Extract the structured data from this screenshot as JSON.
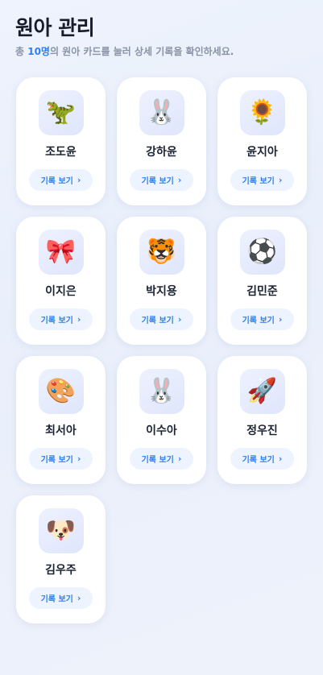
{
  "header": {
    "title": "원아 관리",
    "subtitle_prefix": "총 ",
    "subtitle_count": "10명",
    "subtitle_suffix": "의 원아 카드를 눌러 상세 기록을 확인하세요."
  },
  "record_button_label": "기록 보기",
  "chevron": "›",
  "children": [
    {
      "name": "조도윤",
      "icon": "dinosaur-icon",
      "emoji": "🦖"
    },
    {
      "name": "강하윤",
      "icon": "rabbit-icon",
      "emoji": "🐰"
    },
    {
      "name": "윤지아",
      "icon": "sunflower-icon",
      "emoji": "🌻"
    },
    {
      "name": "이지은",
      "icon": "ribbon-icon",
      "emoji": "🎀"
    },
    {
      "name": "박지용",
      "icon": "tiger-icon",
      "emoji": "🐯"
    },
    {
      "name": "김민준",
      "icon": "soccer-ball-icon",
      "emoji": "⚽"
    },
    {
      "name": "최서아",
      "icon": "palette-icon",
      "emoji": "🎨"
    },
    {
      "name": "이수아",
      "icon": "rabbit-icon",
      "emoji": "🐰"
    },
    {
      "name": "정우진",
      "icon": "rocket-icon",
      "emoji": "🚀"
    },
    {
      "name": "김우주",
      "icon": "dog-icon",
      "emoji": "🐶"
    }
  ],
  "colors": {
    "accent": "#2f80ed",
    "button_bg": "#eef4ff",
    "card_bg": "#ffffff",
    "title": "#161c2b",
    "muted": "#8a93a6"
  }
}
